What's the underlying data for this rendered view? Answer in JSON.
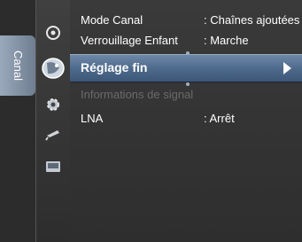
{
  "side_tab": {
    "label": "Canal"
  },
  "menu": {
    "items": [
      {
        "label": "Mode Canal",
        "value": ": Chaînes ajoutées"
      },
      {
        "label": "Verrouillage Enfant",
        "value": ": Marche"
      },
      {
        "label": "Réglage fin",
        "value": "",
        "selected": true
      },
      {
        "label": "Informations de signal",
        "value": "",
        "disabled": true
      },
      {
        "label": "LNA",
        "value": ": Arrêt"
      }
    ]
  },
  "icons": [
    "picture-icon",
    "channel-icon",
    "setup-icon",
    "input-icon",
    "application-icon"
  ],
  "colors": {
    "highlight": "#4e6a8c",
    "text": "#ffffff",
    "disabled": "#6a6a6a"
  }
}
